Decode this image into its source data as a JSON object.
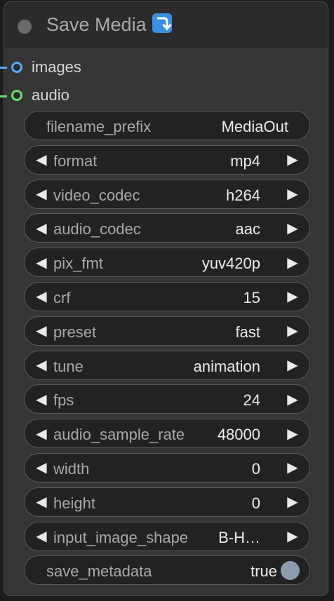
{
  "node": {
    "title": "Save Media",
    "title_icon": "arrow-turn-down-icon"
  },
  "inputs": [
    {
      "label": "images",
      "color": "#5aa7ff"
    },
    {
      "label": "audio",
      "color": "#6bdd6b"
    }
  ],
  "widgets": {
    "filename_prefix": {
      "name": "filename_prefix",
      "value": "MediaOut"
    },
    "format": {
      "name": "format",
      "value": "mp4"
    },
    "video_codec": {
      "name": "video_codec",
      "value": "h264"
    },
    "audio_codec": {
      "name": "audio_codec",
      "value": "aac"
    },
    "pix_fmt": {
      "name": "pix_fmt",
      "value": "yuv420p"
    },
    "crf": {
      "name": "crf",
      "value": "15"
    },
    "preset": {
      "name": "preset",
      "value": "fast"
    },
    "tune": {
      "name": "tune",
      "value": "animation"
    },
    "fps": {
      "name": "fps",
      "value": "24"
    },
    "audio_sample_rate": {
      "name": "audio_sample_rate",
      "value": "48000"
    },
    "width": {
      "name": "width",
      "value": "0"
    },
    "height": {
      "name": "height",
      "value": "0"
    },
    "input_image_shape": {
      "name": "input_image_shape",
      "value": "B-H…"
    },
    "save_metadata": {
      "name": "save_metadata",
      "value": "true"
    }
  },
  "arrows": {
    "left": "◀",
    "right": "▶"
  },
  "colors": {
    "node_bg": "#353535",
    "header_bg": "#2b2b2b",
    "widget_bg": "#222222",
    "images_slot": "#5aa7ff",
    "audio_slot": "#6bdd6b",
    "toggle_on": "#8c9bae"
  }
}
